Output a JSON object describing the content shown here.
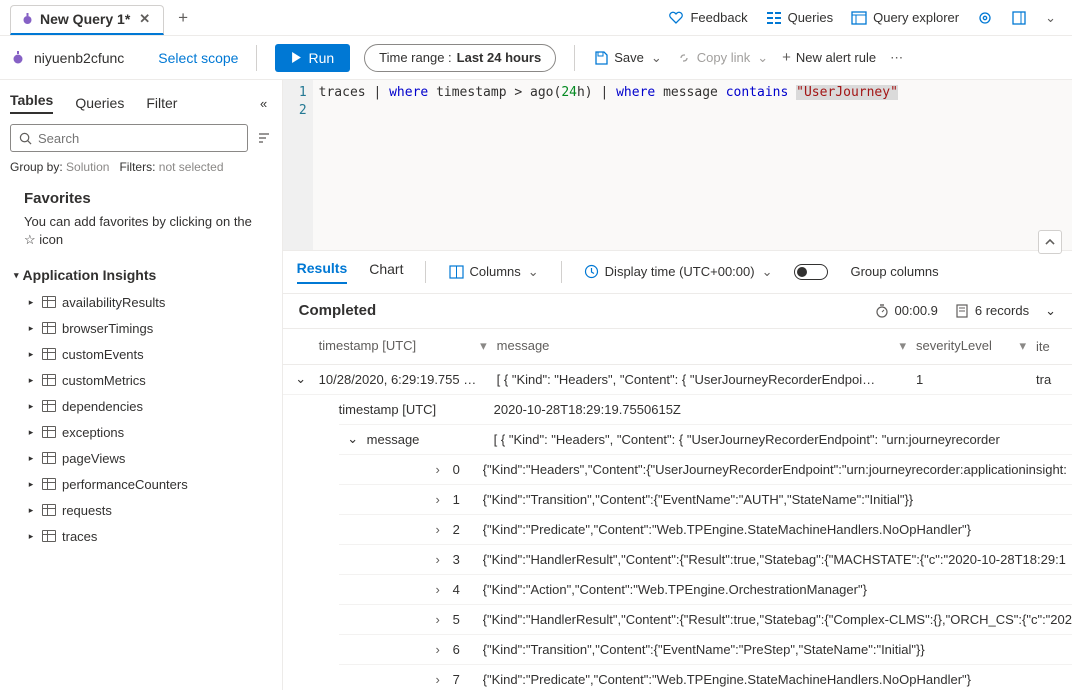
{
  "tab_title": "New Query 1*",
  "top_links": {
    "feedback": "Feedback",
    "queries": "Queries",
    "explorer": "Query explorer"
  },
  "scope": {
    "func": "niyuenb2cfunc",
    "select": "Select scope"
  },
  "toolbar": {
    "run": "Run",
    "time_label": "Time range :",
    "time_value": "Last 24 hours",
    "save": "Save",
    "copy": "Copy link",
    "alert": "New alert rule"
  },
  "sidebar": {
    "tabs": [
      "Tables",
      "Queries",
      "Filter"
    ],
    "search_placeholder": "Search",
    "group_label": "Group by:",
    "group_value": "Solution",
    "filters_label": "Filters:",
    "filters_value": "not selected",
    "fav_heading": "Favorites",
    "fav_text": "You can add favorites by clicking on the ☆ icon",
    "section": "Application Insights",
    "items": [
      "availabilityResults",
      "browserTimings",
      "customEvents",
      "customMetrics",
      "dependencies",
      "exceptions",
      "pageViews",
      "performanceCounters",
      "requests",
      "traces"
    ]
  },
  "editor": {
    "l1_a": "traces ",
    "l1_b": "| ",
    "l1_c": "where",
    "l1_d": " timestamp > ago(",
    "l1_e": "24",
    "l1_f": "h) ",
    "l1_g": "| ",
    "l1_h": "where",
    "l1_i": " message ",
    "l1_j": "contains",
    "l1_k": " ",
    "l1_l": "\"UserJourney\""
  },
  "resultbar": {
    "results": "Results",
    "chart": "Chart",
    "columns": "Columns",
    "display": "Display time (UTC+00:00)",
    "group": "Group columns"
  },
  "status": {
    "state": "Completed",
    "time": "00:00.9",
    "records": "6 records"
  },
  "grid": {
    "headers": {
      "ts": "timestamp [UTC]",
      "msg": "message",
      "sev": "severityLevel",
      "itm": "ite"
    },
    "row": {
      "ts": "10/28/2020, 6:29:19.755 …",
      "msg": "[ { \"Kind\": \"Headers\", \"Content\": { \"UserJourneyRecorderEndpoi…",
      "sev": "1",
      "itm": "tra"
    },
    "detail": {
      "ts_k": "timestamp [UTC]",
      "ts_v": "2020-10-28T18:29:19.7550615Z",
      "msg_k": "message",
      "msg_v": "[ { \"Kind\": \"Headers\", \"Content\": { \"UserJourneyRecorderEndpoint\": \"urn:journeyrecorder",
      "arr": [
        "{\"Kind\":\"Headers\",\"Content\":{\"UserJourneyRecorderEndpoint\":\"urn:journeyrecorder:applicationinsight:",
        "{\"Kind\":\"Transition\",\"Content\":{\"EventName\":\"AUTH\",\"StateName\":\"Initial\"}}",
        "{\"Kind\":\"Predicate\",\"Content\":\"Web.TPEngine.StateMachineHandlers.NoOpHandler\"}",
        "{\"Kind\":\"HandlerResult\",\"Content\":{\"Result\":true,\"Statebag\":{\"MACHSTATE\":{\"c\":\"2020-10-28T18:29:1",
        "{\"Kind\":\"Action\",\"Content\":\"Web.TPEngine.OrchestrationManager\"}",
        "{\"Kind\":\"HandlerResult\",\"Content\":{\"Result\":true,\"Statebag\":{\"Complex-CLMS\":{},\"ORCH_CS\":{\"c\":\"202",
        "{\"Kind\":\"Transition\",\"Content\":{\"EventName\":\"PreStep\",\"StateName\":\"Initial\"}}",
        "{\"Kind\":\"Predicate\",\"Content\":\"Web.TPEngine.StateMachineHandlers.NoOpHandler\"}"
      ]
    }
  }
}
